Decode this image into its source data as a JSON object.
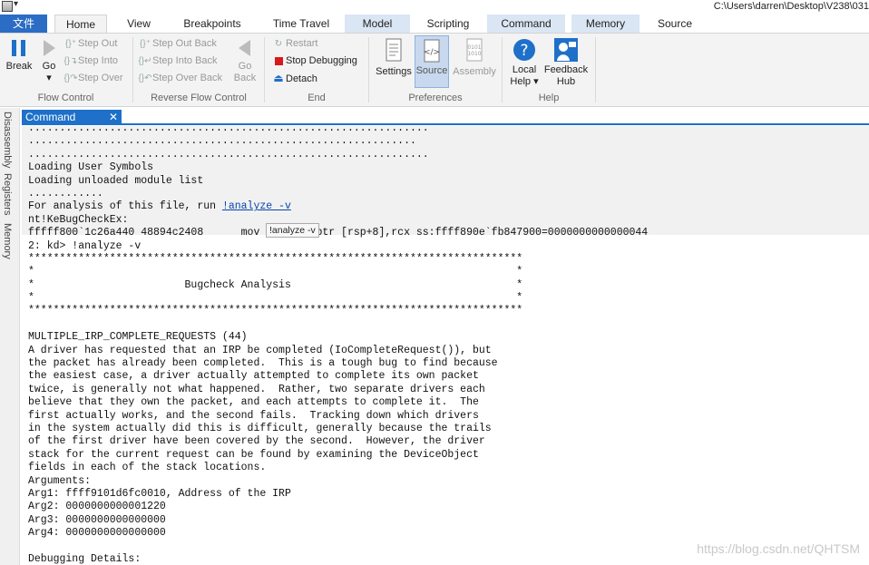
{
  "titlebar": {
    "path": "C:\\Users\\darren\\Desktop\\V238\\031"
  },
  "tabs": {
    "file": "文件",
    "home": "Home",
    "view": "View",
    "breakpoints": "Breakpoints",
    "time_travel": "Time Travel",
    "model": "Model",
    "scripting": "Scripting",
    "command": "Command",
    "memory": "Memory",
    "source": "Source"
  },
  "ribbon": {
    "flow": {
      "break": "Break",
      "go": "Go",
      "step_out": "Step Out",
      "step_into": "Step Into",
      "step_over": "Step Over",
      "label": "Flow Control"
    },
    "reverse": {
      "step_out_back": "Step Out Back",
      "step_into_back": "Step Into Back",
      "step_over_back": "Step Over Back",
      "go_back_1": "Go",
      "go_back_2": "Back",
      "label": "Reverse Flow Control"
    },
    "end": {
      "restart": "Restart",
      "stop": "Stop Debugging",
      "detach": "Detach",
      "label": "End"
    },
    "prefs": {
      "settings": "Settings",
      "source": "Source",
      "assembly": "Assembly",
      "label": "Preferences"
    },
    "help": {
      "local_1": "Local",
      "local_2": "Help",
      "feedback_1": "Feedback",
      "feedback_2": "Hub",
      "label": "Help"
    }
  },
  "left_tabs": [
    "Disassembly",
    "Registers",
    "Memory"
  ],
  "command_window": {
    "tab": "Command",
    "tooltip": "!analyze -v",
    "run_prefix": "For analysis of this file, run ",
    "run_link": "!analyze -v",
    "lines_old": [
      "................................................................",
      "..............................................................",
      "................................................................",
      "Loading User Symbols",
      "Loading unloaded module list",
      "............",
      "__RUNLINE__",
      "nt!KeBugCheckEx:",
      "fffff800`1c26a440 48894c2408      mov   qword ptr [rsp+8],rcx ss:ffff890e`fb847900=0000000000000044"
    ],
    "lines_new": [
      "2: kd> !analyze -v",
      "*******************************************************************************",
      "*                                                                             *",
      "*                        Bugcheck Analysis                                    *",
      "*                                                                             *",
      "*******************************************************************************",
      "",
      "MULTIPLE_IRP_COMPLETE_REQUESTS (44)",
      "A driver has requested that an IRP be completed (IoCompleteRequest()), but",
      "the packet has already been completed.  This is a tough bug to find because",
      "the easiest case, a driver actually attempted to complete its own packet",
      "twice, is generally not what happened.  Rather, two separate drivers each",
      "believe that they own the packet, and each attempts to complete it.  The",
      "first actually works, and the second fails.  Tracking down which drivers",
      "in the system actually did this is difficult, generally because the trails",
      "of the first driver have been covered by the second.  However, the driver",
      "stack for the current request can be found by examining the DeviceObject",
      "fields in each of the stack locations.",
      "Arguments:",
      "Arg1: ffff9101d6fc0010, Address of the IRP",
      "Arg2: 0000000000001220",
      "Arg3: 0000000000000000",
      "Arg4: 0000000000000000",
      "",
      "Debugging Details:"
    ]
  },
  "watermark": "https://blog.csdn.net/QHTSM",
  "colors": {
    "accent": "#1e70c9",
    "file_tab": "#2b6cc4",
    "context_tab": "#dbe6f4",
    "ribbon": "#f3f3f3"
  }
}
